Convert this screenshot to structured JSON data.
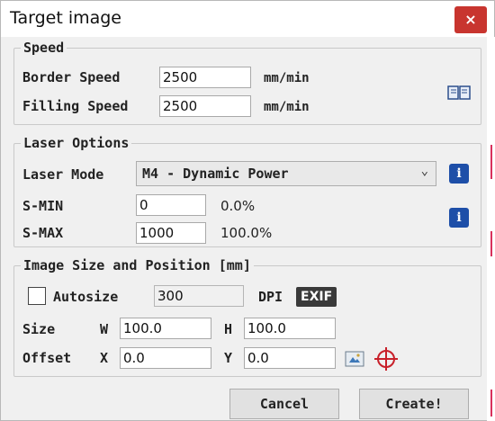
{
  "window": {
    "title": "Target image",
    "close_label": "×"
  },
  "speed": {
    "legend": "Speed",
    "border_label": "Border Speed",
    "border_value": "2500",
    "filling_label": "Filling Speed",
    "filling_value": "2500",
    "unit": "mm/min",
    "help_icon": "book-icon"
  },
  "laser": {
    "legend": "Laser Options",
    "mode_label": "Laser Mode",
    "mode_value": "M4 - Dynamic Power",
    "smin_label": "S-MIN",
    "smin_value": "0",
    "smin_pct": "0.0%",
    "smax_label": "S-MAX",
    "smax_value": "1000",
    "smax_pct": "100.0%",
    "info_label": "i"
  },
  "image": {
    "legend": "Image Size and Position [mm]",
    "autosize_label": "Autosize",
    "autosize_checked": false,
    "dpi_value": "300",
    "dpi_label": "DPI",
    "exif_label": "EXIF",
    "size_label": "Size",
    "w_label": "W",
    "w_value": "100.0",
    "h_label": "H",
    "h_value": "100.0",
    "offset_label": "Offset",
    "x_label": "X",
    "x_value": "0.0",
    "y_label": "Y",
    "y_value": "0.0",
    "icons": [
      "center-icon",
      "crosshair-icon"
    ]
  },
  "buttons": {
    "cancel": "Cancel",
    "create": "Create!"
  },
  "colors": {
    "close": "#c8352f",
    "info": "#1e4fa8",
    "crosshair": "#c8202a",
    "exif": "#3a3a3a"
  }
}
